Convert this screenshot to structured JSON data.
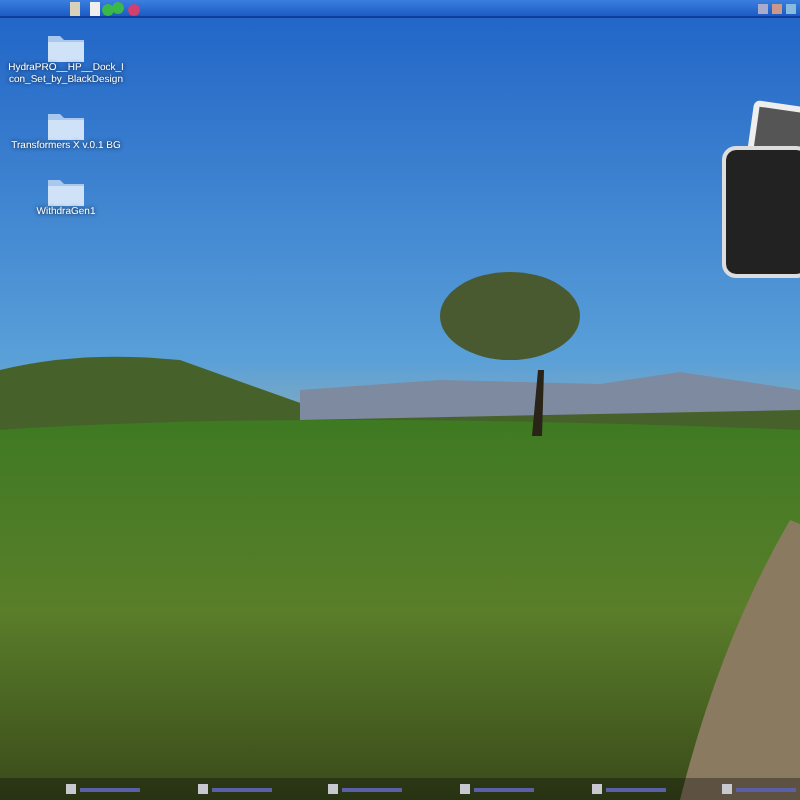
{
  "desktop": {
    "icons": [
      {
        "label": "HydraPRO__HP__Dock_Icon_Set_by_BlackDesign"
      },
      {
        "label": "Transformers X v.0.1 BG"
      },
      {
        "label": "WithdraGen1"
      }
    ]
  }
}
